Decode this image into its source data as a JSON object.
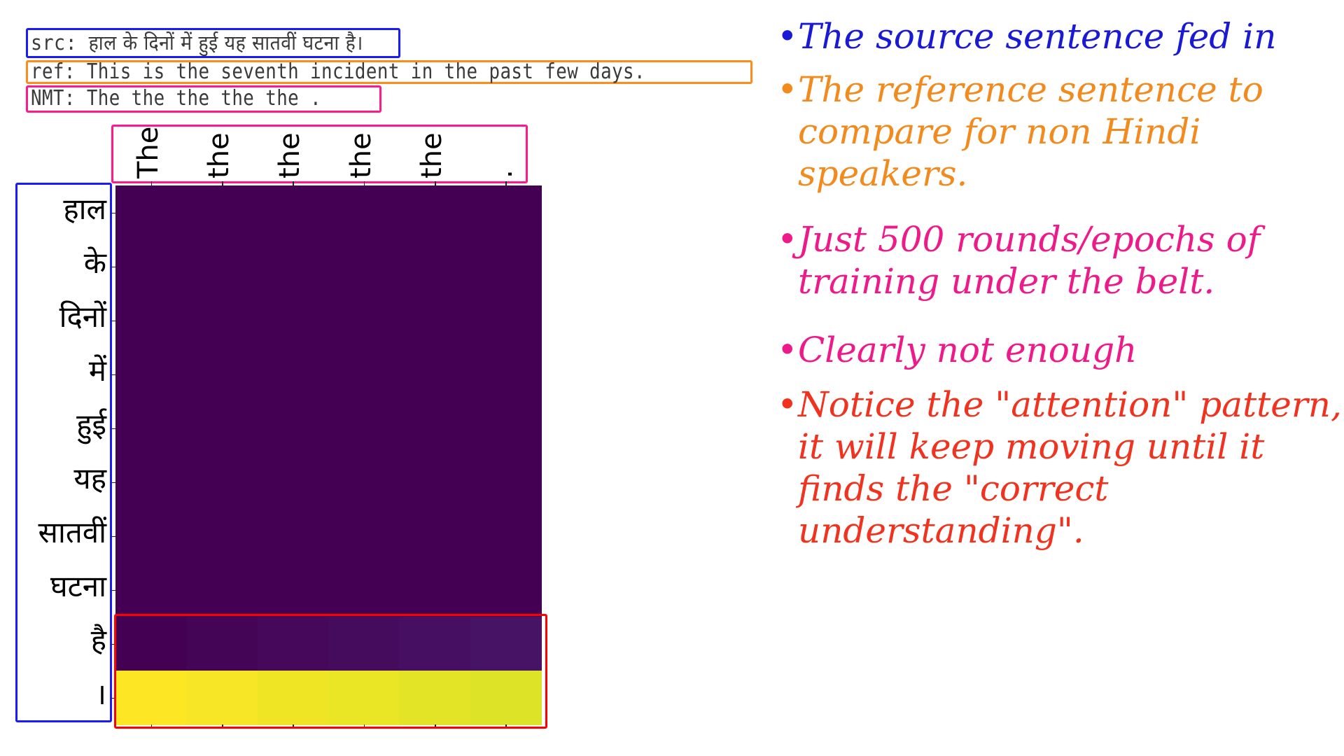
{
  "colors": {
    "src": "#1a1aff",
    "ref": "#ff8c1a",
    "nmt": "#ff1a8c",
    "focus": "#ff0000",
    "note_blue": "#1a1ad6",
    "note_orange": "#f28a1e",
    "note_pink": "#ee1a8a",
    "note_red": "#f0321e"
  },
  "sentences": {
    "src_label": "src:",
    "src_text": "हाल के दिनों में हुई यह सातवीं घटना है।",
    "ref_label": "ref:",
    "ref_text": "This is the seventh incident in the past few days.",
    "nmt_label": "NMT:",
    "nmt_text": "The the the the the ."
  },
  "chart_data": {
    "type": "heatmap",
    "title": "",
    "colormap": "viridis",
    "x_tick_labels": [
      "The",
      "the",
      "the",
      "the",
      "the",
      "."
    ],
    "y_tick_labels": [
      "हाल",
      "के",
      "दिनों",
      "में",
      "हुई",
      "यह",
      "सातवीं",
      "घटना",
      "है",
      "।"
    ],
    "xlabel": "",
    "ylabel": "",
    "value_range": [
      0,
      1
    ],
    "values": [
      [
        0.0,
        0.0,
        0.0,
        0.0,
        0.0,
        0.0
      ],
      [
        0.0,
        0.0,
        0.0,
        0.0,
        0.0,
        0.0
      ],
      [
        0.0,
        0.0,
        0.0,
        0.0,
        0.0,
        0.0
      ],
      [
        0.0,
        0.0,
        0.0,
        0.0,
        0.0,
        0.0
      ],
      [
        0.0,
        0.0,
        0.0,
        0.0,
        0.0,
        0.0
      ],
      [
        0.0,
        0.0,
        0.0,
        0.0,
        0.0,
        0.0
      ],
      [
        0.0,
        0.0,
        0.0,
        0.0,
        0.0,
        0.0
      ],
      [
        0.0,
        0.0,
        0.0,
        0.0,
        0.0,
        0.0
      ],
      [
        0.0,
        0.01,
        0.02,
        0.03,
        0.04,
        0.05
      ],
      [
        1.0,
        0.99,
        0.98,
        0.97,
        0.96,
        0.95
      ]
    ]
  },
  "notes": [
    {
      "text": "The source sentence fed in",
      "color_key": "note_blue",
      "lines": [
        "The source sentence fed in"
      ]
    },
    {
      "text": "The reference sentence to compare for non Hindi speakers.",
      "color_key": "note_orange",
      "lines": [
        "The reference sentence to",
        "compare for non Hindi",
        "speakers."
      ]
    },
    {
      "text": "Just 500 rounds/epochs of training under the belt.",
      "color_key": "note_pink",
      "lines": [
        "Just 500 rounds/epochs of",
        "training under the belt."
      ]
    },
    {
      "text": "Clearly not enough",
      "color_key": "note_pink",
      "lines": [
        "Clearly not enough"
      ]
    },
    {
      "text": "Notice the \"attention\" pattern, it will keep moving until it finds the \"correct understanding\".",
      "color_key": "note_red",
      "lines": [
        "Notice the \"attention\" pattern,",
        "it will keep moving until it",
        "finds the \"correct",
        "understanding\"."
      ]
    }
  ],
  "bullet_symbol": "•"
}
